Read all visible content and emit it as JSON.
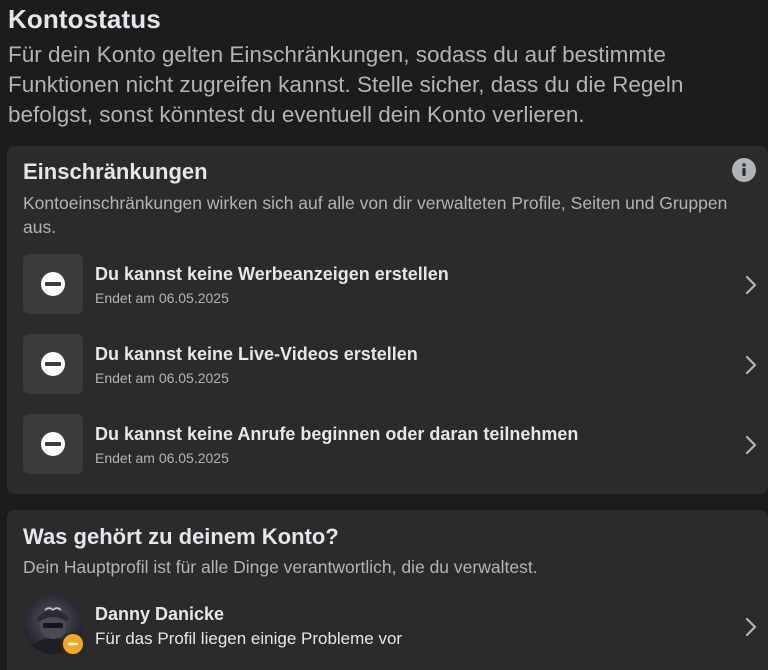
{
  "header": {
    "title": "Kontostatus",
    "description": "Für dein Konto gelten Einschränkungen, sodass du auf bestimmte Funktionen nicht zugreifen kannst. Stelle sicher, dass du die Regeln befolgst, sonst könntest du eventuell dein Konto verlieren."
  },
  "restrictions": {
    "title": "Einschränkungen",
    "description": "Kontoeinschränkungen wirken sich auf alle von dir verwalteten Profile, Seiten und Gruppen aus.",
    "info_icon": "info-icon",
    "items": [
      {
        "label": "Du kannst keine Werbeanzeigen erstellen",
        "ends": "Endet am 06.05.2025",
        "icon": "restricted-icon"
      },
      {
        "label": "Du kannst keine Live-Videos erstellen",
        "ends": "Endet am 06.05.2025",
        "icon": "restricted-icon"
      },
      {
        "label": "Du kannst keine Anrufe beginnen oder daran teilnehmen",
        "ends": "Endet am 06.05.2025",
        "icon": "restricted-icon"
      }
    ]
  },
  "account": {
    "title": "Was gehört zu deinem Konto?",
    "description": "Dein Hauptprofil ist für alle Dinge verantwortlich, die du verwaltest.",
    "profile": {
      "name": "Danny Danicke",
      "status": "Für das Profil liegen einige Probleme vor",
      "badge_icon": "warning-badge-icon"
    }
  },
  "colors": {
    "background": "#1c1c1d",
    "card": "#2b2b2c",
    "icon_box": "#3a3b3c",
    "text_primary": "#e4e6eb",
    "text_secondary": "#b0b3b8",
    "warning": "#f2a823"
  }
}
